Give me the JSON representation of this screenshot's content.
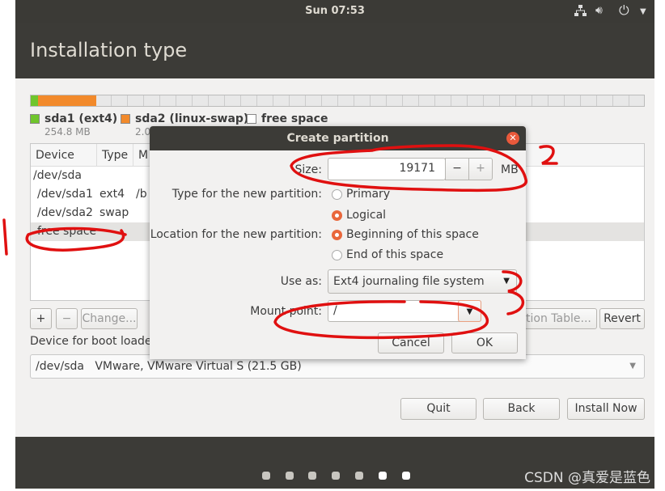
{
  "topbar": {
    "clock": "Sun 07:53",
    "icons": [
      "network-icon",
      "volume-icon",
      "power-icon",
      "chevron-down-icon"
    ]
  },
  "window": {
    "title": "Installation type"
  },
  "legend": [
    {
      "label": "sda1 (ext4)",
      "size": "254.8 MB",
      "color": "#6fc52c"
    },
    {
      "label": "sda2 (linux-swap)",
      "size": "2.0",
      "color": "#f28a2b"
    },
    {
      "label": "free space",
      "color": "#ffffff"
    }
  ],
  "table": {
    "columns": [
      "Device",
      "Type",
      "M"
    ],
    "rows": [
      {
        "device": "/dev/sda",
        "type": "",
        "mount": ""
      },
      {
        "device": "/dev/sda1",
        "type": "ext4",
        "mount": "/b"
      },
      {
        "device": "/dev/sda2",
        "type": "swap",
        "mount": ""
      },
      {
        "device": "free space",
        "type": "",
        "mount": ""
      }
    ]
  },
  "toolbar": {
    "add": "+",
    "remove": "−",
    "change": "Change...",
    "new_table": "ition Table...",
    "revert": "Revert"
  },
  "boot": {
    "label": "Device for boot loader",
    "value": "/dev/sda   VMware, VMware Virtual S (21.5 GB)"
  },
  "buttons": {
    "quit": "Quit",
    "back": "Back",
    "install": "Install Now"
  },
  "watermark": "CSDN @真爱是蓝色",
  "dialog": {
    "title": "Create partition",
    "size_label": "Size:",
    "size_value": "19171",
    "size_unit": "MB",
    "type_label": "Type for the new partition:",
    "type_options": [
      "Primary",
      "Logical"
    ],
    "type_selected": "Logical",
    "location_label": "Location for the new partition:",
    "location_options": [
      "Beginning of this space",
      "End of this space"
    ],
    "location_selected": "Beginning of this space",
    "useas_label": "Use as:",
    "useas_value": "Ext4 journaling file system",
    "mount_label": "Mount point:",
    "mount_value": "/",
    "cancel": "Cancel",
    "ok": "OK"
  },
  "annotations": [
    "1",
    "2",
    "3"
  ],
  "colors": {
    "accent": "#e9673b",
    "annotation": "#e01010"
  }
}
